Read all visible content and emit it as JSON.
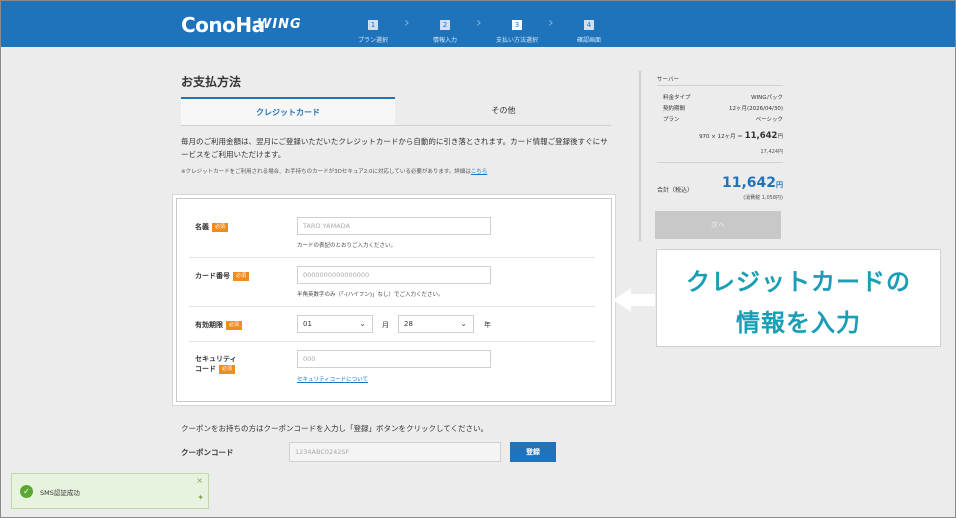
{
  "header": {
    "logo": "ConoHa",
    "logo_sub": "WING",
    "steps": [
      {
        "num": "1",
        "label": "プラン選択"
      },
      {
        "num": "2",
        "label": "情報入力"
      },
      {
        "num": "3",
        "label": "支払い方法選択"
      },
      {
        "num": "4",
        "label": "確認画面"
      }
    ],
    "active_step": 3
  },
  "payment": {
    "title": "お支払方法",
    "tabs": [
      "クレジットカード",
      "その他"
    ],
    "description": "毎月のご利用金額は、翌月にご登録いただいたクレジットカードから自動的に引き落とされます。カード情報ご登録後すぐにサービスをご利用いただけます。",
    "note": "※クレジットカードをご利用される場合、お手持ちのカードが3Dセキュア2.0に対応している必要があります。詳細は",
    "note_link": "こちら"
  },
  "form": {
    "required_badge": "必須",
    "name": {
      "label": "名義",
      "placeholder": "TARO YAMADA",
      "hint": "カードの表記のとおりご入力ください。"
    },
    "card_number": {
      "label": "カード番号",
      "placeholder": "0000000000000000",
      "hint": "半角英数字のみ（「-(ハイフン)」なし）でご入力ください。"
    },
    "expiry": {
      "label": "有効期限",
      "month": "01",
      "month_unit": "月",
      "year": "28",
      "year_unit": "年"
    },
    "security": {
      "label_line1": "セキュリティ",
      "label_line2": "コード",
      "placeholder": "000",
      "link": "セキュリティコードについて"
    }
  },
  "coupon": {
    "text": "クーポンをお持ちの方はクーポンコードを入力し「登録」ボタンをクリックしてください。",
    "label": "クーポンコード",
    "placeholder": "1234ABC0242SF",
    "button": "登録"
  },
  "summary": {
    "title": "サーバー",
    "rows": [
      {
        "label": "料金タイプ",
        "value": "WINGパック"
      },
      {
        "label": "契約期間",
        "value": "12ヶ月(2026/04/30)"
      },
      {
        "label": "プラン",
        "value": "ベーシック"
      }
    ],
    "calc_prefix": "970 × 12ヶ月 ＝",
    "calc_value": "11,642",
    "calc_unit": "円",
    "calc_tax": "17,424円",
    "total_label": "合計（税込）",
    "total_value": "11,642",
    "total_unit": "円",
    "total_tax": "(消費税 1,058円)",
    "next_button": "次へ"
  },
  "callout": {
    "line1": "クレジットカードの",
    "line2": "情報を入力"
  },
  "toast": {
    "message": "SMS認証成功"
  }
}
